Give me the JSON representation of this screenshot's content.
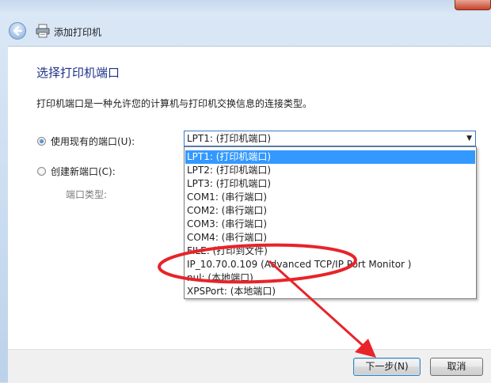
{
  "window": {
    "title": "添加打印机"
  },
  "page": {
    "heading": "选择打印机端口",
    "description": "打印机端口是一种允许您的计算机与打印机交换信息的连接类型。",
    "use_existing_label": "使用现有的端口(U):",
    "create_new_label": "创建新端口(C):",
    "port_type_label": "端口类型:"
  },
  "port_select": {
    "value": "LPT1: (打印机端口)",
    "options": [
      "LPT1: (打印机端口)",
      "LPT2: (打印机端口)",
      "LPT3: (打印机端口)",
      "COM1: (串行端口)",
      "COM2: (串行端口)",
      "COM3: (串行端口)",
      "COM4: (串行端口)",
      "FILE: (打印到文件)",
      "IP_10.70.0.109 (Advanced TCP/IP Port Monitor )",
      "nul: (本地端口)",
      "XPSPort: (本地端口)"
    ],
    "selected_index": 0
  },
  "buttons": {
    "next": "下一步(N)",
    "cancel": "取消"
  },
  "colors": {
    "accent": "#3399ff",
    "annotation": "#e8232a",
    "heading": "#1e3287"
  },
  "icons": {
    "back": "back-arrow-icon",
    "printer": "printer-icon"
  }
}
